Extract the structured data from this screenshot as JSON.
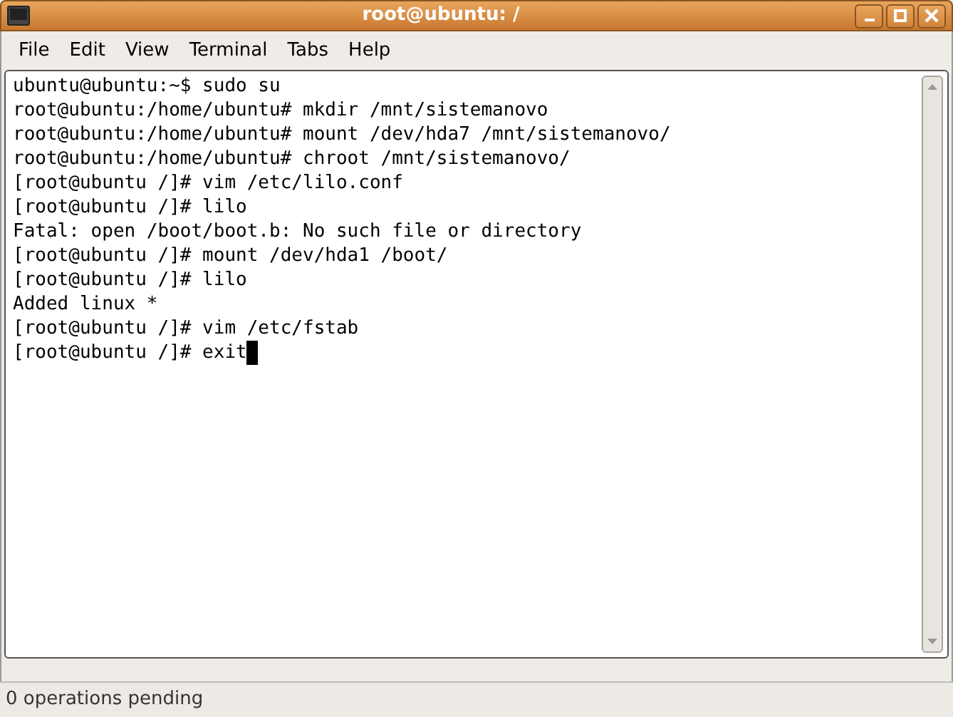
{
  "window": {
    "title": "root@ubuntu: /"
  },
  "menu": [
    "File",
    "Edit",
    "View",
    "Terminal",
    "Tabs",
    "Help"
  ],
  "terminal": {
    "lines": [
      {
        "text": "ubuntu@ubuntu:~$ sudo su",
        "cursor": false
      },
      {
        "text": "root@ubuntu:/home/ubuntu# mkdir /mnt/sistemanovo",
        "cursor": false
      },
      {
        "text": "root@ubuntu:/home/ubuntu# mount /dev/hda7 /mnt/sistemanovo/",
        "cursor": false
      },
      {
        "text": "root@ubuntu:/home/ubuntu# chroot /mnt/sistemanovo/",
        "cursor": false
      },
      {
        "text": "[root@ubuntu /]# vim /etc/lilo.conf",
        "cursor": false
      },
      {
        "text": "[root@ubuntu /]# lilo",
        "cursor": false
      },
      {
        "text": "Fatal: open /boot/boot.b: No such file or directory",
        "cursor": false
      },
      {
        "text": "[root@ubuntu /]# mount /dev/hda1 /boot/",
        "cursor": false
      },
      {
        "text": "[root@ubuntu /]# lilo",
        "cursor": false
      },
      {
        "text": "Added linux *",
        "cursor": false
      },
      {
        "text": "[root@ubuntu /]# vim /etc/fstab",
        "cursor": false
      },
      {
        "text": "[root@ubuntu /]# exit",
        "cursor": true
      }
    ]
  },
  "status_bar": "0 operations pending"
}
